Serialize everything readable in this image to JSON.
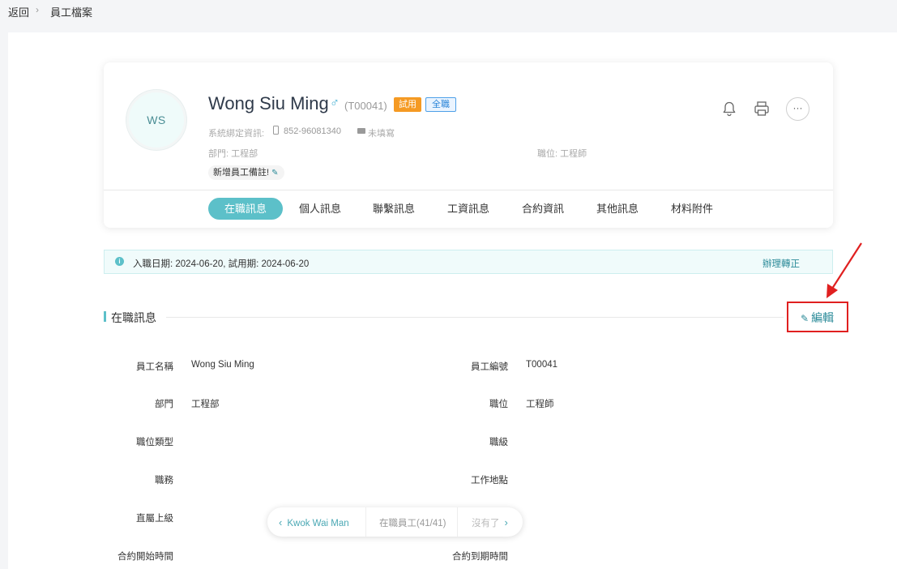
{
  "breadcrumb": {
    "back": "返回",
    "separator": "›",
    "current": "員工檔案"
  },
  "profile": {
    "avatar_initials": "WS",
    "name": "Wong Siu Ming",
    "gender_symbol": "♂",
    "employee_no_display": "(T00041)",
    "tag_trial": "試用",
    "tag_fulltime": "全職",
    "system_binding_label": "系統綁定資訊:",
    "phone": "852-96081340",
    "email": "未填寫",
    "department_info": "部門: 工程部",
    "position_info": "職位: 工程師",
    "note_button": "新增員工備註!"
  },
  "tabs": [
    {
      "label": "在職訊息",
      "active": true
    },
    {
      "label": "個人訊息"
    },
    {
      "label": "聯繫訊息"
    },
    {
      "label": "工資訊息"
    },
    {
      "label": "合約資訊"
    },
    {
      "label": "其他訊息"
    },
    {
      "label": "材料附件"
    }
  ],
  "notice": {
    "text": "入職日期: 2024-06-20, 試用期: 2024-06-20",
    "action": "辦理轉正"
  },
  "section": {
    "title": "在職訊息",
    "edit": "編輯"
  },
  "fields": {
    "left": [
      {
        "label": "員工名稱",
        "value": "Wong Siu Ming"
      },
      {
        "label": "部門",
        "value": "工程部"
      },
      {
        "label": "職位類型",
        "value": ""
      },
      {
        "label": "職務",
        "value": ""
      },
      {
        "label": "直屬上級",
        "value": ""
      },
      {
        "label": "合約開始時間",
        "value": ""
      }
    ],
    "right": [
      {
        "label": "員工編號",
        "value": "T00041"
      },
      {
        "label": "職位",
        "value": "工程師"
      },
      {
        "label": "職級",
        "value": ""
      },
      {
        "label": "工作地點",
        "value": ""
      },
      {
        "label": "",
        "value": ""
      },
      {
        "label": "合約到期時間",
        "value": ""
      }
    ]
  },
  "pager": {
    "prev_name": "Kwok Wai Man",
    "status": "在職員工(41/41)",
    "next_label": "沒有了"
  },
  "colors": {
    "accent": "#5cc0c9",
    "trial_tag": "#f59a23",
    "annotation": "#e02020"
  }
}
